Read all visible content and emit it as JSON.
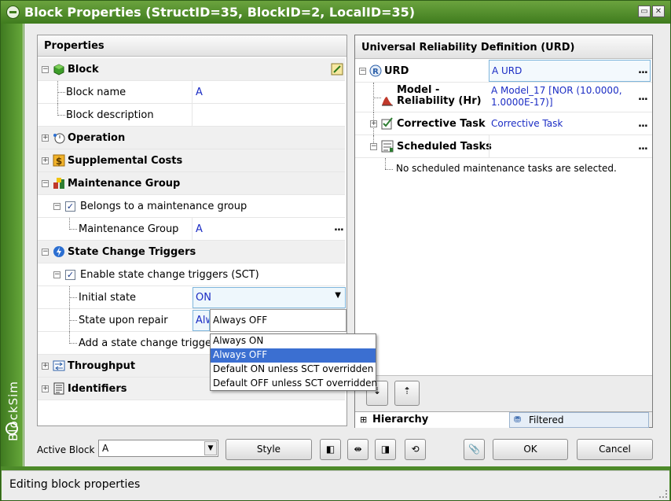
{
  "window": {
    "title": "Block Properties (StructID=35, BlockID=2, LocalID=35)",
    "brand": "BlockSim",
    "accent_color": "#4d8a2a"
  },
  "properties": {
    "header": "Properties",
    "categories": {
      "block": "Block",
      "operation": "Operation",
      "supplemental_costs": "Supplemental Costs",
      "maintenance_group": "Maintenance Group",
      "state_change_triggers": "State Change Triggers",
      "throughput": "Throughput",
      "identifiers": "Identifiers"
    },
    "block_name_label": "Block name",
    "block_name_value": "A",
    "block_description_label": "Block description",
    "belongs_label": "Belongs to a maintenance group",
    "maintenance_group_label": "Maintenance Group",
    "maintenance_group_value": "A",
    "enable_sct_label": "Enable state change triggers (SCT)",
    "initial_state_label": "Initial state",
    "initial_state_value": "ON",
    "state_upon_repair_label": "State upon repair",
    "state_upon_repair_partial": "Alw",
    "state_upon_repair_value": "Always OFF",
    "add_trigger_label": "Add a state change trigger",
    "dropdown_options": [
      "Always ON",
      "Always OFF",
      "Default ON unless SCT overridden",
      "Default OFF unless SCT overridden"
    ],
    "dropdown_selected": "Always OFF",
    "ellipsis": "..."
  },
  "urd": {
    "header": "Universal Reliability Definition (URD)",
    "root_label": "URD",
    "root_value": "A URD",
    "model_label": "Model - Reliability (Hr)",
    "model_value": "A Model_17 [NOR (10.0000, 1.0000E-17)]",
    "corrective_label": "Corrective Task",
    "corrective_value": "Corrective Task",
    "scheduled_label": "Scheduled Tasks",
    "no_tasks_text": "No scheduled maintenance tasks are selected.",
    "tab_hierarchy": "Hierarchy",
    "tab_filtered": "Filtered",
    "ellipsis": "..."
  },
  "footer": {
    "active_block_label": "Active Block",
    "active_block_value": "A",
    "style_label": "Style",
    "ok_label": "OK",
    "cancel_label": "Cancel"
  },
  "status": {
    "text": "Editing block properties"
  }
}
